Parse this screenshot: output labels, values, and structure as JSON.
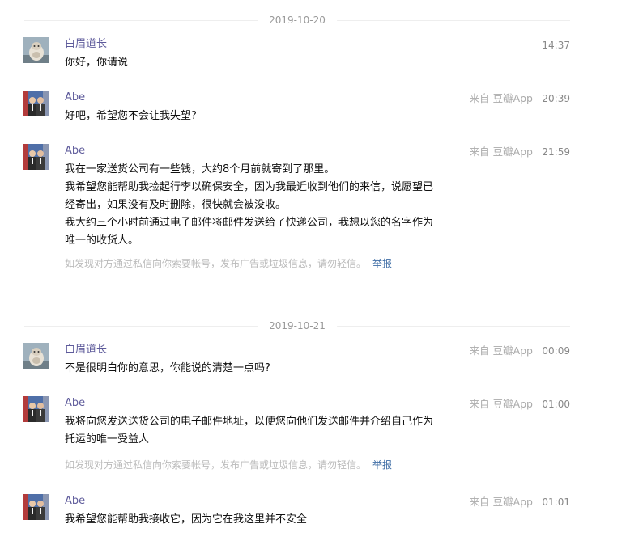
{
  "dates": [
    "2019-10-20",
    "2019-10-21"
  ],
  "report": {
    "notice": "如发现对方通过私信向你索要帐号，发布广告或垃圾信息，请勿轻信。",
    "link": "举报"
  },
  "messages": [
    {
      "sender": "白眉道长",
      "source": "",
      "time": "14:37",
      "lines": [
        "你好，你请说"
      ]
    },
    {
      "sender": "Abe",
      "source": "来自 豆瓣App",
      "time": "20:39",
      "lines": [
        "好吧，希望您不会让我失望?"
      ]
    },
    {
      "sender": "Abe",
      "source": "来自 豆瓣App",
      "time": "21:59",
      "lines": [
        "我在一家送货公司有一些钱，大约8个月前就寄到了那里。",
        "我希望您能帮助我捡起行李以确保安全，因为我最近收到他们的来信，说愿望已经寄出，如果没有及时删除，很快就会被没收。",
        "我大约三个小时前通过电子邮件将邮件发送给了快递公司，我想以您的名字作为唯一的收货人。"
      ]
    },
    {
      "sender": "白眉道长",
      "source": "来自 豆瓣App",
      "time": "00:09",
      "lines": [
        "不是很明白你的意思，你能说的清楚一点吗?"
      ]
    },
    {
      "sender": "Abe",
      "source": "来自 豆瓣App",
      "time": "01:00",
      "lines": [
        "我将向您发送送货公司的电子邮件地址，以便您向他们发送邮件并介绍自己作为托运的唯一受益人"
      ]
    },
    {
      "sender": "Abe",
      "source": "来自 豆瓣App",
      "time": "01:01",
      "lines": [
        "我希望您能帮助我接收它，因为它在我这里并不安全"
      ]
    }
  ]
}
